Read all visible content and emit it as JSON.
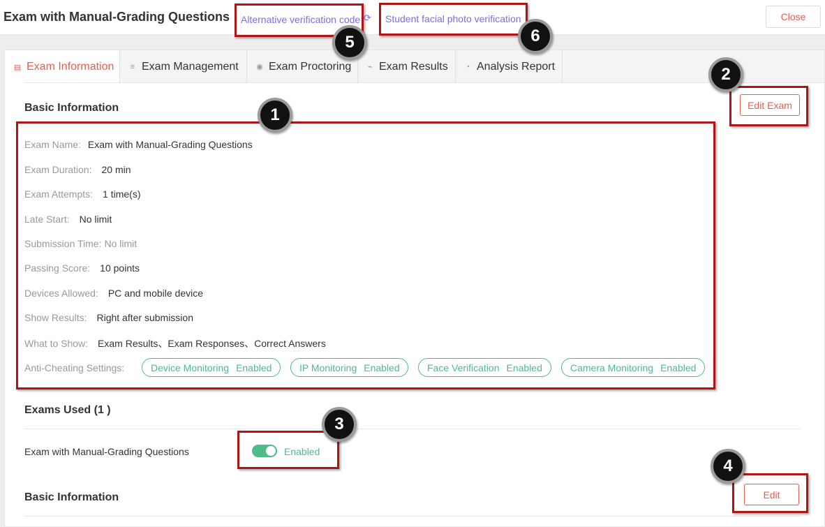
{
  "header": {
    "title": "Exam with Manual-Grading Questions",
    "alt_code_link": "Alternative verification code",
    "facial_link": "Student facial photo verification",
    "close_label": "Close"
  },
  "tabs": [
    {
      "label": "Exam Information",
      "icon": "document-icon"
    },
    {
      "label": "Exam Management",
      "icon": "manage-icon"
    },
    {
      "label": "Exam Proctoring",
      "icon": "eye-icon"
    },
    {
      "label": "Exam Results",
      "icon": "chart-icon"
    },
    {
      "label": "Analysis Report",
      "icon": "pie-icon"
    }
  ],
  "basic_info": {
    "title": "Basic Information",
    "edit_label": "Edit Exam",
    "rows": [
      {
        "label": "Exam Name:",
        "value": "Exam with Manual-Grading Questions"
      },
      {
        "label": "Exam Duration:",
        "value": "20 min"
      },
      {
        "label": "Exam Attempts:",
        "value": "1 time(s)"
      },
      {
        "label": "Late Start:",
        "value": "No limit"
      },
      {
        "label": "Submission Time:",
        "value": "No limit"
      },
      {
        "label": "Passing Score:",
        "value": "10 points"
      },
      {
        "label": "Devices Allowed:",
        "value": "PC and mobile device"
      },
      {
        "label": "Show Results:",
        "value": "Right after submission"
      },
      {
        "label": "What to Show:",
        "value": "Exam Results、Exam Responses、Correct Answers"
      }
    ],
    "anti_cheating_label": "Anti-Cheating Settings:",
    "anti_cheating": [
      {
        "name": "Device Monitoring",
        "status": "Enabled"
      },
      {
        "name": "IP Monitoring",
        "status": "Enabled"
      },
      {
        "name": "Face Verification",
        "status": "Enabled"
      },
      {
        "name": "Camera Monitoring",
        "status": "Enabled"
      }
    ]
  },
  "exams_used": {
    "title": "Exams Used (1 )",
    "item_name": "Exam with Manual-Grading Questions",
    "toggle_status": "Enabled",
    "toggle_on": true
  },
  "basic_info_2": {
    "title": "Basic Information",
    "edit_label": "Edit"
  },
  "callouts": [
    "1",
    "2",
    "3",
    "4",
    "5",
    "6"
  ],
  "colors": {
    "accent": "#e55e4e",
    "success": "#4dbb8a",
    "link": "#7b6ee6",
    "highlight": "#b01515"
  }
}
